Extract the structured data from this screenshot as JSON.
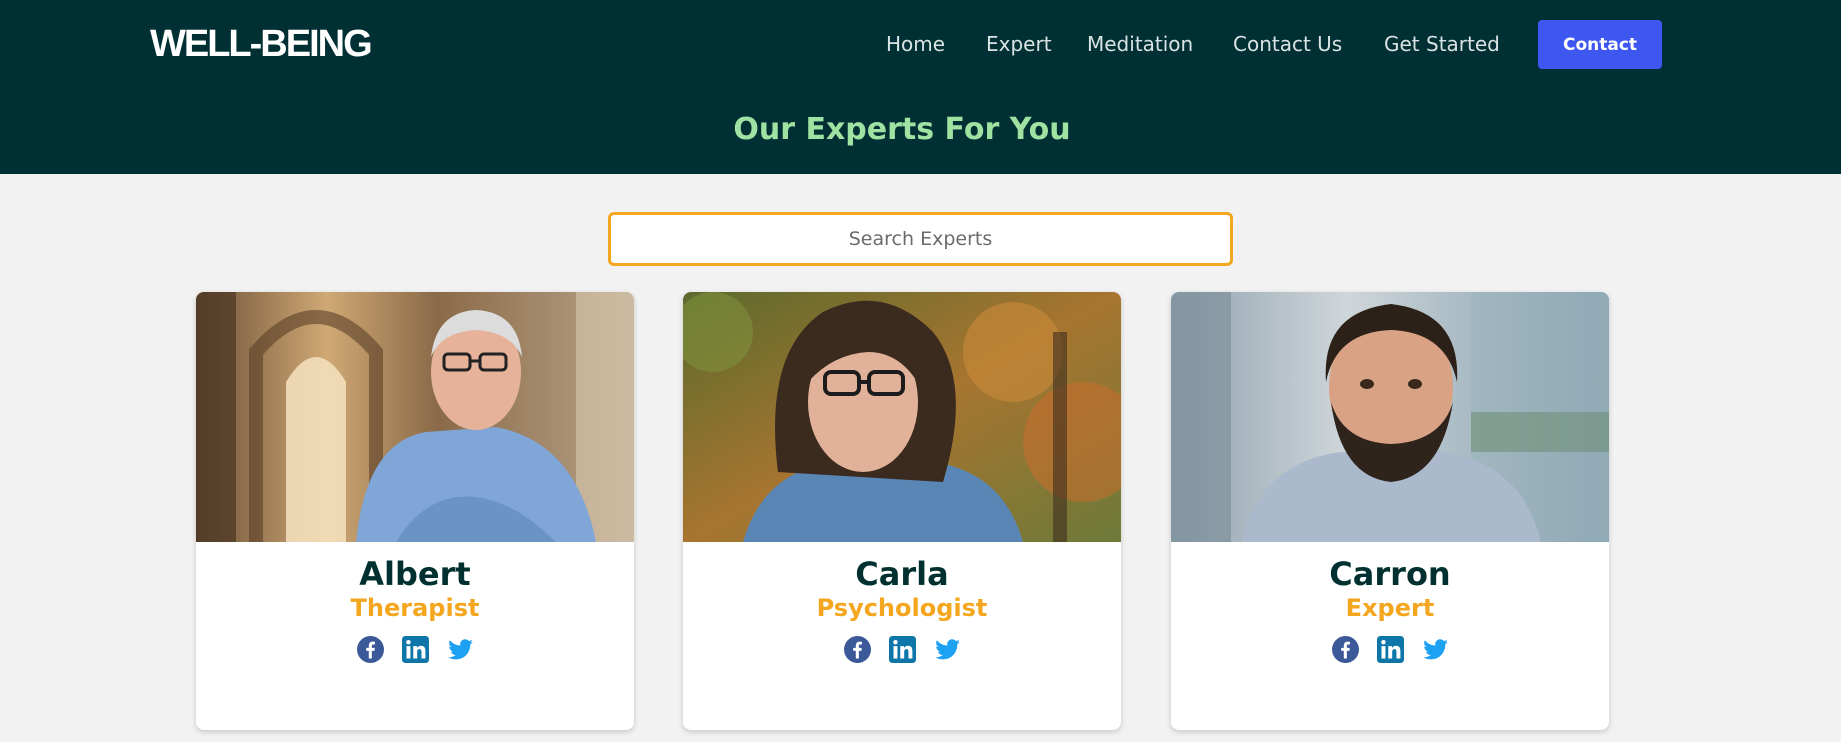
{
  "brand": {
    "logo": "WELL-BEING"
  },
  "nav": {
    "items": [
      "Home",
      "Expert",
      "Meditation",
      "Contact Us",
      "Get Started"
    ],
    "contact_label": "Contact"
  },
  "page": {
    "title": "Our Experts For You"
  },
  "search": {
    "placeholder": "Search Experts",
    "value": ""
  },
  "experts": [
    {
      "name": "Albert",
      "role": "Therapist"
    },
    {
      "name": "Carla",
      "role": "Psychologist"
    },
    {
      "name": "Carron",
      "role": "Expert"
    }
  ],
  "socials": [
    "facebook-icon",
    "linkedin-icon",
    "twitter-icon"
  ],
  "colors": {
    "header_bg": "#003033",
    "title": "#9fe2a2",
    "accent": "#f4a61e",
    "button": "#3d57f0",
    "facebook": "#3b5998",
    "linkedin": "#0e76a8",
    "twitter": "#1da1f2"
  }
}
